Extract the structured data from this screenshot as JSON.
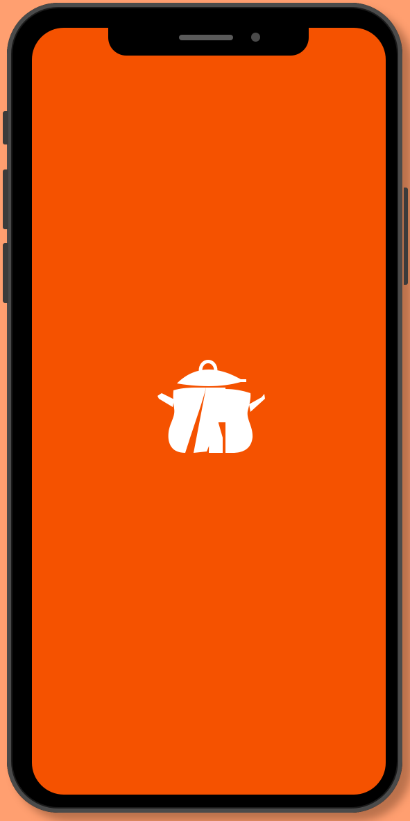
{
  "app": {
    "screen": "splash",
    "icon": "cooking-pot-logo-icon"
  },
  "colors": {
    "background": "#ff9f70",
    "screen": "#f55200",
    "logo": "#ffffff",
    "device": "#000000"
  }
}
